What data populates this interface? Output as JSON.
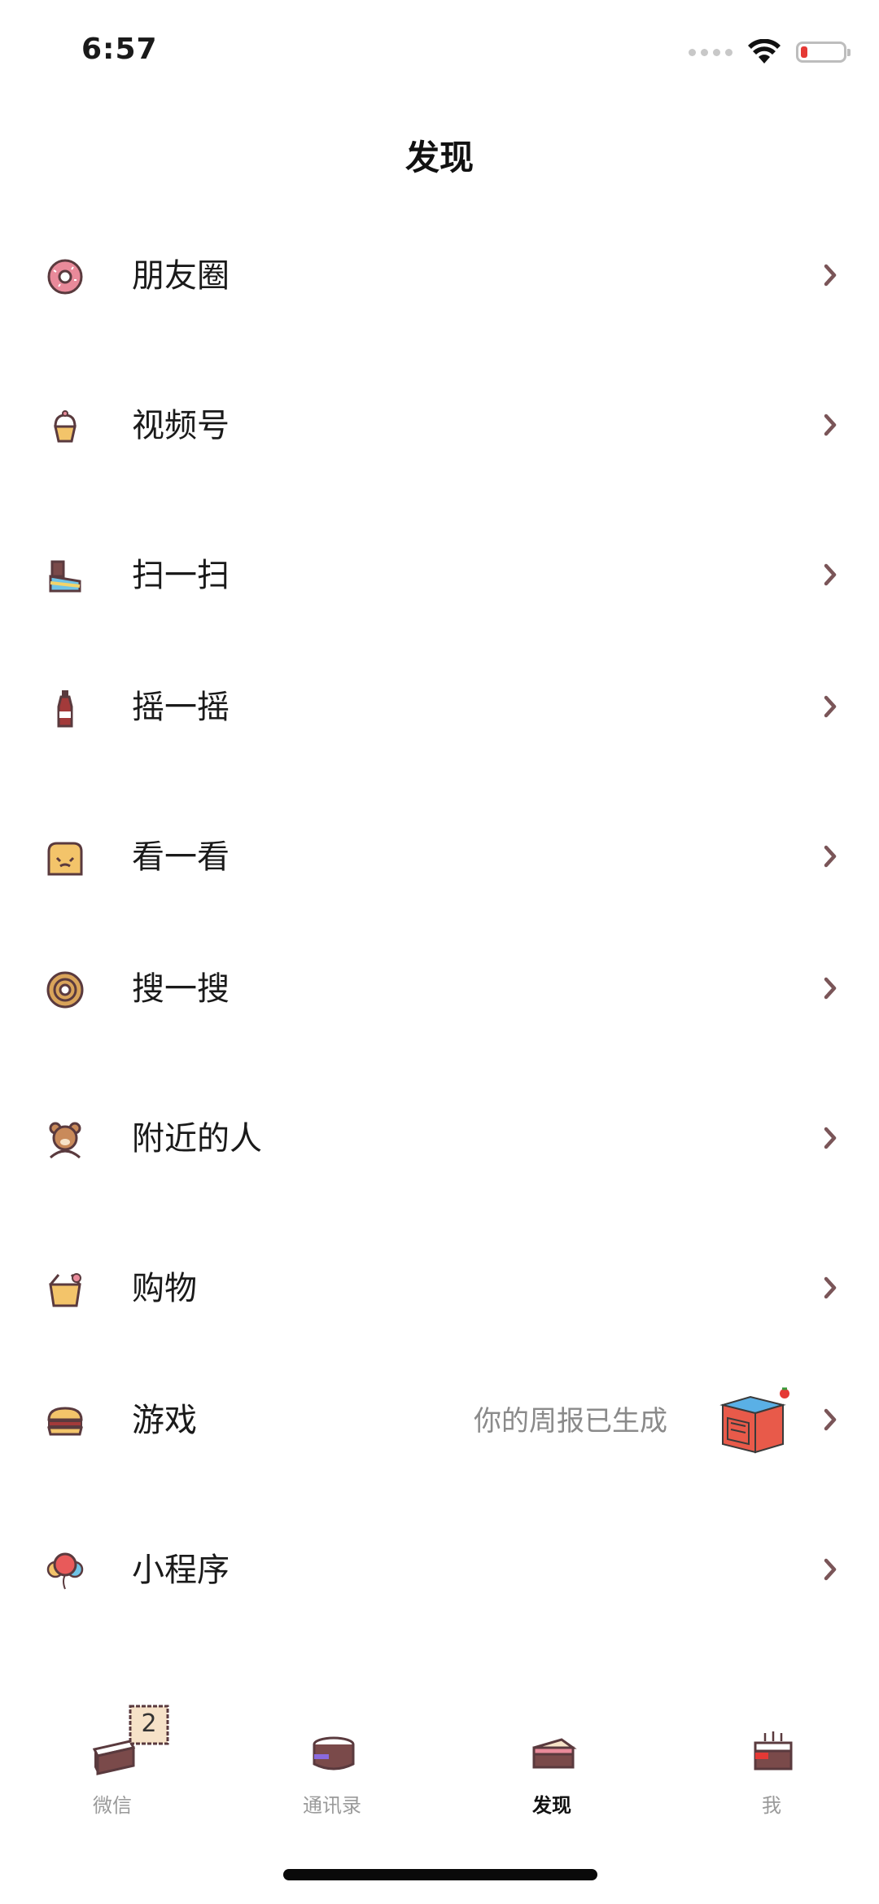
{
  "status_bar": {
    "time": "6:57"
  },
  "header": {
    "title": "发现"
  },
  "menu": [
    {
      "label": "朋友圈",
      "icon": "donut-icon"
    },
    {
      "label": "视频号",
      "icon": "cupcake-icon"
    },
    {
      "label": "扫一扫",
      "icon": "chocolate-cake-icon"
    },
    {
      "label": "摇一摇",
      "icon": "soda-bottle-icon"
    },
    {
      "label": "看一看",
      "icon": "toast-icon"
    },
    {
      "label": "搜一搜",
      "icon": "cinnamon-roll-icon"
    },
    {
      "label": "附近的人",
      "icon": "bear-icon"
    },
    {
      "label": "购物",
      "icon": "takeout-box-icon"
    },
    {
      "label": "游戏",
      "icon": "burger-icon",
      "extra_text": "你的周报已生成",
      "extra_icon": "weekly-report-cake-icon"
    },
    {
      "label": "小程序",
      "icon": "balloon-icon"
    }
  ],
  "tabs": [
    {
      "label": "微信",
      "icon": "cake-slice-icon",
      "badge": "2"
    },
    {
      "label": "通讯录",
      "icon": "cake-cup-icon"
    },
    {
      "label": "发现",
      "icon": "cake-layer-icon",
      "active": true
    },
    {
      "label": "我",
      "icon": "birthday-cake-icon"
    }
  ],
  "colors": {
    "chevron": "#7a5558",
    "active_tab_text": "#111111",
    "inactive_tab_text": "#9a9a9a",
    "secondary_text": "#8a8a8a"
  }
}
